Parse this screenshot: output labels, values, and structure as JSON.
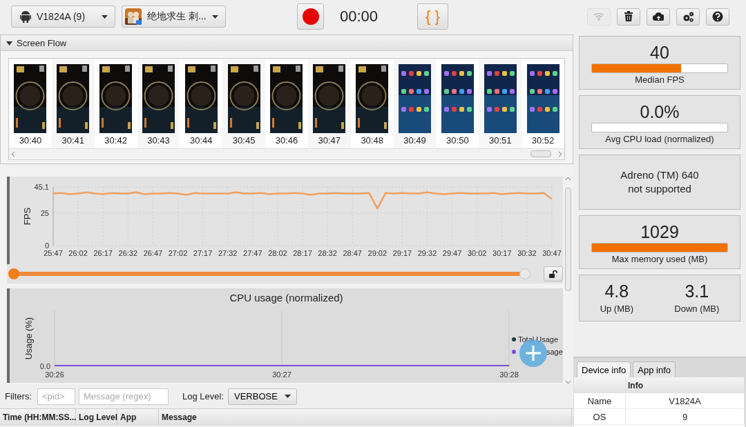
{
  "toolbar": {
    "device_selector": {
      "value": "V1824A (9)"
    },
    "app_selector": {
      "value": "绝地求生 刺..."
    },
    "timer": "00:00",
    "code_button": {
      "label": "{ }"
    },
    "tools": [
      {
        "kind": "wifi",
        "disabled": true
      },
      {
        "kind": "trash",
        "disabled": false
      },
      {
        "kind": "upload",
        "disabled": false
      },
      {
        "kind": "settings",
        "disabled": false
      },
      {
        "kind": "help",
        "disabled": false
      }
    ]
  },
  "screen_flow": {
    "title": "Screen Flow",
    "expanded": true,
    "frames": [
      {
        "time": "30:40",
        "kind": "dark-picture"
      },
      {
        "time": "30:41",
        "kind": "dark-picture"
      },
      {
        "time": "30:42",
        "kind": "dark-picture"
      },
      {
        "time": "30:43",
        "kind": "dark-picture"
      },
      {
        "time": "30:44",
        "kind": "dark-picture"
      },
      {
        "time": "30:45",
        "kind": "dark-picture"
      },
      {
        "time": "30:46",
        "kind": "dark-picture"
      },
      {
        "time": "30:47",
        "kind": "dark-picture"
      },
      {
        "time": "30:48",
        "kind": "dark-picture"
      },
      {
        "time": "30:49",
        "kind": "grid-picture"
      },
      {
        "time": "30:50",
        "kind": "grid-picture"
      },
      {
        "time": "30:51",
        "kind": "grid-picture"
      },
      {
        "time": "30:52",
        "kind": "grid-picture"
      }
    ]
  },
  "charts": [
    {
      "chart_data": {
        "type": "line",
        "ylabel": "FPS",
        "grid": true,
        "ylim": [
          0,
          45.1
        ],
        "yticks": [
          0,
          25,
          45.1
        ],
        "categories": [
          "25:47",
          null,
          null,
          "26:02",
          null,
          null,
          "26:17",
          null,
          null,
          "26:32",
          null,
          null,
          "26:47",
          null,
          null,
          "27:02",
          null,
          null,
          "27:17",
          null,
          null,
          "27:32",
          null,
          null,
          "27:47",
          null,
          null,
          "28:02",
          null,
          null,
          "28:17",
          null,
          null,
          "28:32",
          null,
          null,
          "28:47",
          null,
          null,
          "29:02",
          null,
          null,
          "29:17",
          null,
          null,
          "29:32",
          null,
          null,
          "29:47",
          null,
          null,
          "30:02",
          null,
          null,
          "30:17",
          null,
          null,
          "30:32",
          null,
          null,
          "30:47"
        ],
        "series": [
          {
            "color": "#f0a060",
            "values": [
              40,
              40.5,
              39.5,
              40,
              41,
              40,
              39.5,
              40.5,
              40,
              40,
              41,
              39.5,
              40,
              40,
              40.5,
              40,
              39,
              40.5,
              40,
              40,
              40,
              40,
              41,
              40,
              40,
              40.5,
              39.5,
              40,
              40,
              40.5,
              40,
              39,
              40,
              40,
              40.5,
              40,
              40,
              40,
              40.5,
              28.5,
              40.5,
              40,
              40.5,
              40,
              40,
              41,
              40,
              39.5,
              40,
              40.5,
              40,
              40,
              40,
              40.5,
              39.5,
              40,
              40.5,
              40,
              40,
              40.5,
              36
            ]
          }
        ]
      },
      "slider": {
        "level": 1
      }
    },
    {
      "title": "CPU usage (normalized)",
      "ylabel": "Usage (%)",
      "y_label": "0.0",
      "x_labels": [
        "30:26",
        "30:27",
        "30:28"
      ],
      "legend": [
        {
          "name": "Total Usage",
          "color": "#1e3c3c"
        },
        {
          "name": "sage",
          "color": "#7a4fd8"
        }
      ]
    }
  ],
  "log": {
    "filters_label": "Filters:",
    "pid_filter": {
      "placeholder": "<pid>"
    },
    "message_filter": {
      "placeholder": "Message (regex)"
    },
    "level_label": "Log Level:",
    "level_select": {
      "value": "VERBOSE"
    },
    "columns": [
      "Time (HH:MM:SS...",
      "Log Level",
      "App",
      "Message"
    ]
  },
  "stats": [
    {
      "kind": "meter",
      "value": "40",
      "level": 0.66,
      "caption": "Median FPS"
    },
    {
      "kind": "meter",
      "value": "0.0%",
      "level": 0,
      "caption": "Avg CPU load (normalized)"
    },
    {
      "kind": "message",
      "lines": [
        "Adreno (TM) 640",
        "not supported"
      ]
    },
    {
      "kind": "meter",
      "value": "1029",
      "level": 1,
      "caption": "Max memory used (MB)"
    },
    {
      "kind": "pair",
      "items": [
        {
          "value": "4.8",
          "caption": "Up (MB)"
        },
        {
          "value": "3.1",
          "caption": "Down (MB)"
        }
      ]
    }
  ],
  "info_panel": {
    "tabs": [
      {
        "label": "Device info",
        "selected": true
      },
      {
        "label": "App info",
        "selected": false
      }
    ],
    "columns": [
      "Info"
    ],
    "rows": [
      [
        "Name",
        "V1824A"
      ],
      [
        "OS",
        "9"
      ]
    ]
  }
}
